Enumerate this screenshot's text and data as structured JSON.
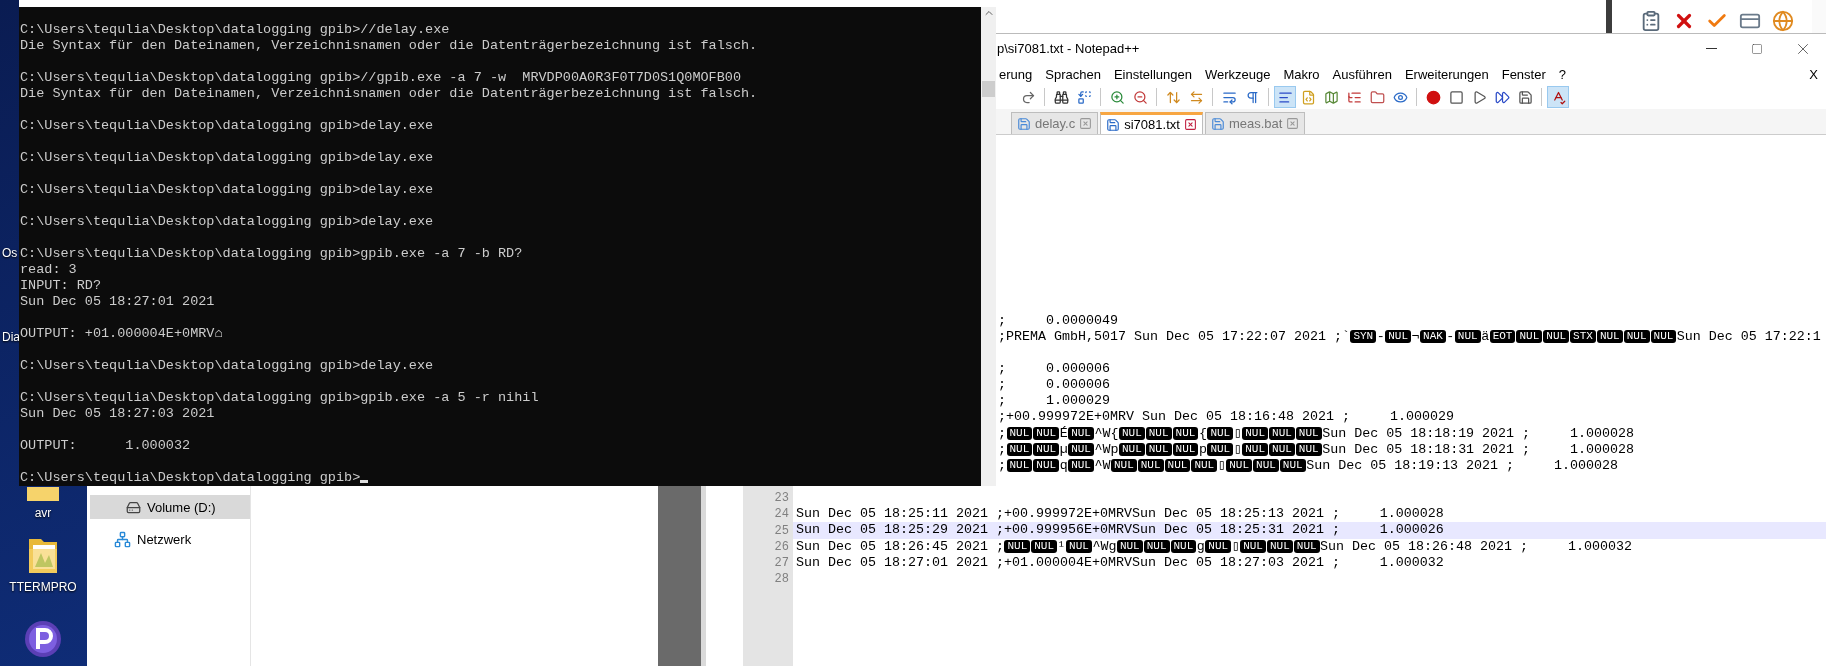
{
  "desktop": {
    "clipped_labels": [
      "Os",
      "Dia"
    ],
    "icons": [
      {
        "label": "avr",
        "kind": "folder"
      },
      {
        "label": "TTERMPRO",
        "kind": "photo-folder"
      },
      {
        "kind": "app"
      }
    ]
  },
  "console": {
    "cursor": true,
    "blocks": [
      [
        "C:\\Users\\tequlia\\Desktop\\datalogging gpib>//delay.exe",
        "Die Syntax für den Dateinamen, Verzeichnisnamen oder die Datenträgerbezeichnung ist falsch."
      ],
      [
        "C:\\Users\\tequlia\\Desktop\\datalogging gpib>//gpib.exe -a 7 -w  MRVDP00A0R3F0T7D0S1Q0MOFB00",
        "Die Syntax für den Dateinamen, Verzeichnisnamen oder die Datenträgerbezeichnung ist falsch."
      ],
      [
        "C:\\Users\\tequlia\\Desktop\\datalogging gpib>delay.exe"
      ],
      [
        "C:\\Users\\tequlia\\Desktop\\datalogging gpib>delay.exe"
      ],
      [
        "C:\\Users\\tequlia\\Desktop\\datalogging gpib>delay.exe"
      ],
      [
        "C:\\Users\\tequlia\\Desktop\\datalogging gpib>delay.exe"
      ],
      [
        "C:\\Users\\tequlia\\Desktop\\datalogging gpib>gpib.exe -a 7 -b RD?",
        "read: 3",
        "INPUT: RD?",
        "Sun Dec 05 18:27:01 2021"
      ],
      [
        "OUTPUT: +01.000004E+0MRV⌂"
      ],
      [
        "C:\\Users\\tequlia\\Desktop\\datalogging gpib>delay.exe"
      ],
      [
        "C:\\Users\\tequlia\\Desktop\\datalogging gpib>gpib.exe -a 5 -r nihil",
        "Sun Dec 05 18:27:03 2021"
      ],
      [
        "OUTPUT:      1.000032"
      ],
      [
        "C:\\Users\\tequlia\\Desktop\\datalogging gpib>"
      ]
    ]
  },
  "explorer": {
    "nav_items": [
      {
        "label": "Volume (D:)",
        "kind": "drive",
        "selected": true
      },
      {
        "label": "Netzwerk",
        "kind": "network",
        "selected": false
      }
    ]
  },
  "tray_toolbar": [
    {
      "kind": "clipboard"
    },
    {
      "kind": "cross"
    },
    {
      "kind": "check"
    },
    {
      "kind": "card"
    },
    {
      "kind": "globe"
    }
  ],
  "notepad": {
    "title": "p\\si7081.txt - Notepad++",
    "menu": [
      "erung",
      "Sprachen",
      "Einstellungen",
      "Werkzeuge",
      "Makro",
      "Ausführen",
      "Erweiterungen",
      "Fenster",
      "?"
    ],
    "doc_close": "X",
    "toolbar": [
      {
        "kind": "redo",
        "pressed": false
      },
      {
        "kind": "separator"
      },
      {
        "kind": "find",
        "pressed": false
      },
      {
        "kind": "replace",
        "pressed": false
      },
      {
        "kind": "separator"
      },
      {
        "kind": "zoom-in",
        "pressed": false
      },
      {
        "kind": "zoom-out",
        "pressed": false
      },
      {
        "kind": "separator"
      },
      {
        "kind": "sync-vertical",
        "pressed": false
      },
      {
        "kind": "sync-horizontal",
        "pressed": false
      },
      {
        "kind": "separator"
      },
      {
        "kind": "wrap",
        "pressed": false
      },
      {
        "kind": "pilcrow",
        "pressed": false
      },
      {
        "kind": "separator"
      },
      {
        "kind": "indent",
        "pressed": true
      },
      {
        "kind": "lang",
        "pressed": false
      },
      {
        "kind": "map",
        "pressed": false
      },
      {
        "kind": "function",
        "pressed": false
      },
      {
        "kind": "folder",
        "pressed": false
      },
      {
        "kind": "eye",
        "pressed": false
      },
      {
        "kind": "separator"
      },
      {
        "kind": "record",
        "pressed": false
      },
      {
        "kind": "stop",
        "pressed": false
      },
      {
        "kind": "play",
        "pressed": false
      },
      {
        "kind": "fast-forward",
        "pressed": false
      },
      {
        "kind": "save",
        "pressed": false
      },
      {
        "kind": "separator"
      },
      {
        "kind": "spell",
        "pressed": true
      }
    ],
    "tabs": [
      {
        "label": "delay.c",
        "selected": false
      },
      {
        "label": "si7081.txt",
        "selected": true
      },
      {
        "label": "meas.bat",
        "selected": false
      }
    ],
    "lines": [
      {
        "kind": "clipped",
        "current": false,
        "segments": [
          {
            "kind": "text",
            "text": ";     0.0000049"
          }
        ]
      },
      {
        "kind": "clipped",
        "current": false,
        "segments": [
          {
            "kind": "text",
            "text": ";PREMA GmbH,5017 Sun Dec 05 17:22:07 2021 ;`"
          },
          {
            "kind": "ctrl",
            "text": "SYN"
          },
          {
            "kind": "text",
            "text": "-"
          },
          {
            "kind": "ctrl",
            "text": "NUL"
          },
          {
            "kind": "text",
            "text": "¬"
          },
          {
            "kind": "ctrl",
            "text": "NAK"
          },
          {
            "kind": "text",
            "text": "-"
          },
          {
            "kind": "ctrl",
            "text": "NUL"
          },
          {
            "kind": "text",
            "text": "ä"
          },
          {
            "kind": "ctrl",
            "text": "EOT"
          },
          {
            "kind": "ctrl",
            "text": "NUL"
          },
          {
            "kind": "ctrl",
            "text": "NUL"
          },
          {
            "kind": "ctrl",
            "text": "STX"
          },
          {
            "kind": "ctrl",
            "text": "NUL"
          },
          {
            "kind": "ctrl",
            "text": "NUL"
          },
          {
            "kind": "ctrl",
            "text": "NUL"
          },
          {
            "kind": "text",
            "text": "Sun Dec 05 17:22:1"
          }
        ]
      },
      {
        "kind": "blank",
        "current": false
      },
      {
        "kind": "clipped",
        "current": false,
        "segments": [
          {
            "kind": "text",
            "text": ";     0.000006"
          }
        ]
      },
      {
        "kind": "clipped",
        "current": false,
        "segments": [
          {
            "kind": "text",
            "text": ";     0.000006"
          }
        ]
      },
      {
        "kind": "clipped",
        "current": false,
        "segments": [
          {
            "kind": "text",
            "text": ";     1.000029"
          }
        ]
      },
      {
        "kind": "clipped",
        "current": false,
        "segments": [
          {
            "kind": "text",
            "text": ";+00.999972E+0MRV Sun Dec 05 18:16:48 2021 ;     1.000029"
          }
        ]
      },
      {
        "kind": "clipped",
        "current": false,
        "segments": [
          {
            "kind": "text",
            "text": ";"
          },
          {
            "kind": "ctrl",
            "text": "NUL"
          },
          {
            "kind": "ctrl",
            "text": "NUL"
          },
          {
            "kind": "text",
            "text": "É"
          },
          {
            "kind": "ctrl",
            "text": "NUL"
          },
          {
            "kind": "text",
            "text": "^W{"
          },
          {
            "kind": "ctrl",
            "text": "NUL"
          },
          {
            "kind": "ctrl",
            "text": "NUL"
          },
          {
            "kind": "ctrl",
            "text": "NUL"
          },
          {
            "kind": "text",
            "text": "{"
          },
          {
            "kind": "ctrl",
            "text": "NUL"
          },
          {
            "kind": "text",
            "text": "▯"
          },
          {
            "kind": "ctrl",
            "text": "NUL"
          },
          {
            "kind": "ctrl",
            "text": "NUL"
          },
          {
            "kind": "ctrl",
            "text": "NUL"
          },
          {
            "kind": "text",
            "text": "Sun Dec 05 18:18:19 2021 ;     1.000028"
          }
        ]
      },
      {
        "kind": "clipped",
        "current": false,
        "segments": [
          {
            "kind": "text",
            "text": ";"
          },
          {
            "kind": "ctrl",
            "text": "NUL"
          },
          {
            "kind": "ctrl",
            "text": "NUL"
          },
          {
            "kind": "text",
            "text": "µ"
          },
          {
            "kind": "ctrl",
            "text": "NUL"
          },
          {
            "kind": "text",
            "text": "^Wp"
          },
          {
            "kind": "ctrl",
            "text": "NUL"
          },
          {
            "kind": "ctrl",
            "text": "NUL"
          },
          {
            "kind": "ctrl",
            "text": "NUL"
          },
          {
            "kind": "text",
            "text": "p"
          },
          {
            "kind": "ctrl",
            "text": "NUL"
          },
          {
            "kind": "text",
            "text": "▯"
          },
          {
            "kind": "ctrl",
            "text": "NUL"
          },
          {
            "kind": "ctrl",
            "text": "NUL"
          },
          {
            "kind": "ctrl",
            "text": "NUL"
          },
          {
            "kind": "text",
            "text": "Sun Dec 05 18:18:31 2021 ;     1.000028"
          }
        ]
      },
      {
        "kind": "clipped",
        "current": false,
        "segments": [
          {
            "kind": "text",
            "text": ";"
          },
          {
            "kind": "ctrl",
            "text": "NUL"
          },
          {
            "kind": "ctrl",
            "text": "NUL"
          },
          {
            "kind": "text",
            "text": "q"
          },
          {
            "kind": "ctrl",
            "text": "NUL"
          },
          {
            "kind": "text",
            "text": "^W"
          },
          {
            "kind": "ctrl",
            "text": "NUL"
          },
          {
            "kind": "ctrl",
            "text": "NUL"
          },
          {
            "kind": "ctrl",
            "text": "NUL"
          },
          {
            "kind": "ctrl",
            "text": "NUL"
          },
          {
            "kind": "text",
            "text": "▯"
          },
          {
            "kind": "ctrl",
            "text": "NUL"
          },
          {
            "kind": "ctrl",
            "text": "NUL"
          },
          {
            "kind": "ctrl",
            "text": "NUL"
          },
          {
            "kind": "text",
            "text": "Sun Dec 05 18:19:13 2021 ;     1.000028"
          }
        ]
      },
      {
        "kind": "blank",
        "current": false
      },
      {
        "kind": "numbered",
        "number": "23",
        "current": false
      },
      {
        "kind": "numbered",
        "number": "24",
        "current": false,
        "segments": [
          {
            "kind": "text",
            "text": "Sun Dec 05 18:25:11 2021 ;+00.999972E+0MRVSun Dec 05 18:25:13 2021 ;     1.000028"
          }
        ]
      },
      {
        "kind": "numbered",
        "number": "25",
        "current": true,
        "segments": [
          {
            "kind": "text",
            "text": "Sun Dec 05 18:25:29 2021 ;+00.999956E+0MRVSun Dec 05 18:25:31 2021 ;     1.000026"
          }
        ]
      },
      {
        "kind": "numbered",
        "number": "26",
        "current": false,
        "segments": [
          {
            "kind": "text",
            "text": "Sun Dec 05 18:26:45 2021 ;"
          },
          {
            "kind": "ctrl",
            "text": "NUL"
          },
          {
            "kind": "ctrl",
            "text": "NUL"
          },
          {
            "kind": "text",
            "text": "¹"
          },
          {
            "kind": "ctrl",
            "text": "NUL"
          },
          {
            "kind": "text",
            "text": "^Wg"
          },
          {
            "kind": "ctrl",
            "text": "NUL"
          },
          {
            "kind": "ctrl",
            "text": "NUL"
          },
          {
            "kind": "ctrl",
            "text": "NUL"
          },
          {
            "kind": "text",
            "text": "g"
          },
          {
            "kind": "ctrl",
            "text": "NUL"
          },
          {
            "kind": "text",
            "text": "▯"
          },
          {
            "kind": "ctrl",
            "text": "NUL"
          },
          {
            "kind": "ctrl",
            "text": "NUL"
          },
          {
            "kind": "ctrl",
            "text": "NUL"
          },
          {
            "kind": "text",
            "text": "Sun Dec 05 18:26:48 2021 ;     1.000032"
          }
        ]
      },
      {
        "kind": "numbered",
        "number": "27",
        "current": false,
        "segments": [
          {
            "kind": "text",
            "text": "Sun Dec 05 18:27:01 2021 ;+01.000004E+0MRVSun Dec 05 18:27:03 2021 ;     1.000032"
          }
        ]
      },
      {
        "kind": "numbered",
        "number": "28",
        "current": false
      }
    ]
  }
}
